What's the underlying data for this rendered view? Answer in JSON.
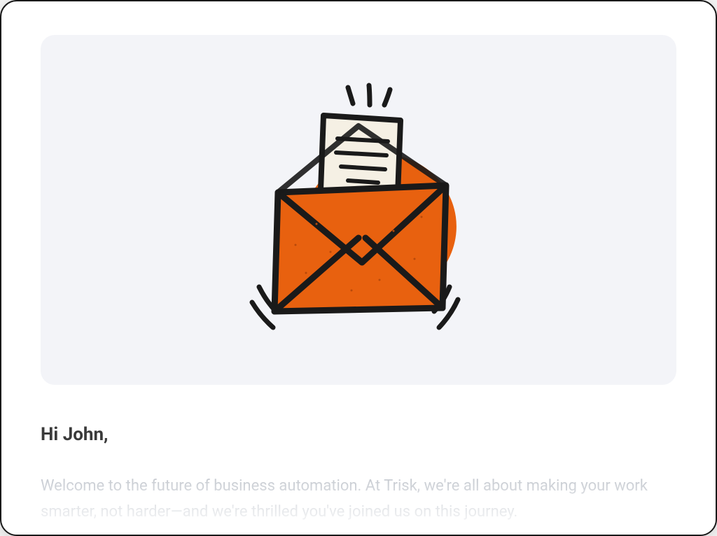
{
  "email": {
    "greeting": "Hi John,",
    "body": "Welcome to the future of business automation. At Trisk, we're all about making your work smarter, not harder—and we're thrilled you've joined us on this journey."
  },
  "illustration": {
    "name": "envelope-with-letter",
    "colors": {
      "envelope": "#e8610f",
      "paper": "#f5f0e4",
      "outline": "#1a1a1a"
    }
  }
}
